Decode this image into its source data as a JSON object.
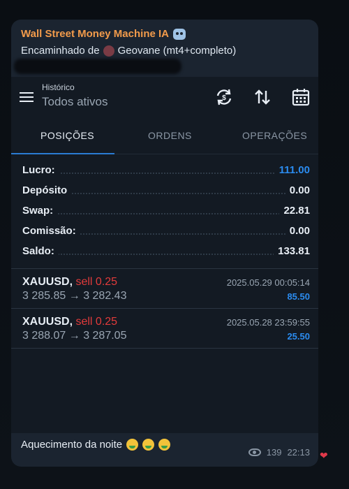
{
  "message": {
    "channel_title": "Wall Street Money Machine IA",
    "forwarded_label": "Encaminhado de",
    "forwarded_from": "Geovane (mt4+completo)",
    "caption": "Aquecimento da noite",
    "views": "139",
    "time": "22:13"
  },
  "app": {
    "header_small": "Histórico",
    "header_title": "Todos ativos",
    "tabs": [
      "POSIÇÕES",
      "ORDENS",
      "OPERAÇÕES"
    ],
    "active_tab": "POSIÇÕES"
  },
  "summary": [
    {
      "label": "Lucro:",
      "value": "111.00"
    },
    {
      "label": "Depósito",
      "value": "0.00"
    },
    {
      "label": "Swap:",
      "value": "22.81"
    },
    {
      "label": "Comissão:",
      "value": "0.00"
    },
    {
      "label": "Saldo:",
      "value": "133.81"
    }
  ],
  "trades": [
    {
      "symbol": "XAUUSD,",
      "direction": "sell 0.25",
      "open": "3 285.85",
      "arrow": "→",
      "close": "3 282.43",
      "datetime": "2025.05.29 00:05:14",
      "profit": "85.50"
    },
    {
      "symbol": "XAUUSD,",
      "direction": "sell 0.25",
      "open": "3 288.07",
      "arrow": "→",
      "close": "3 287.05",
      "datetime": "2025.05.28 23:59:55",
      "profit": "25.50"
    }
  ],
  "colors": {
    "accent_blue": "#2b8cf0",
    "sell_red": "#e23b3b",
    "channel_orange": "#f29b4b"
  },
  "icons": [
    "robot-icon",
    "menu-icon",
    "currency-exchange-icon",
    "sort-icon",
    "calendar-icon",
    "eye-icon",
    "heart-icon"
  ]
}
